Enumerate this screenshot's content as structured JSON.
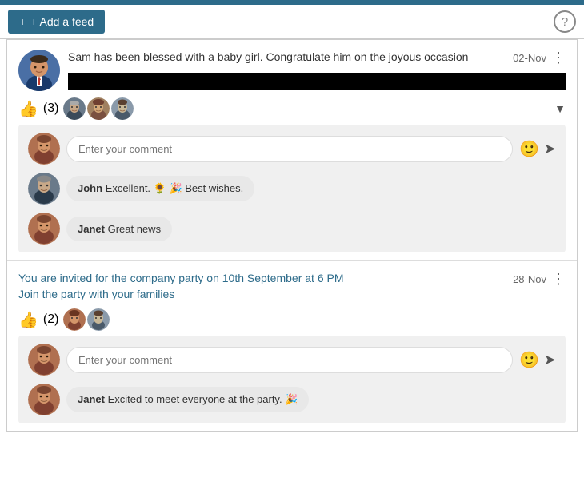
{
  "toolbar": {
    "add_feed_label": "+ Add a feed",
    "help_icon": "?"
  },
  "posts": [
    {
      "id": "post1",
      "date": "02-Nov",
      "text": "Sam has been blessed with a baby girl. Congratulate him on the joyous occasion",
      "has_image": true,
      "likes_count": "(3)",
      "comments": [
        {
          "author": "John",
          "text": "Excellent. 🌻 🎉 Best wishes."
        },
        {
          "author": "Janet",
          "text": "Great news"
        }
      ],
      "comment_placeholder": "Enter your comment"
    },
    {
      "id": "post2",
      "date": "28-Nov",
      "text_line1": "You are invited for the company party on 10th September at 6 PM",
      "text_line2": "Join the party with your families",
      "has_image": false,
      "likes_count": "(2)",
      "comments": [
        {
          "author": "Janet",
          "text": "Excited to meet everyone at the party. 🎉"
        }
      ],
      "comment_placeholder": "Enter your comment"
    }
  ]
}
